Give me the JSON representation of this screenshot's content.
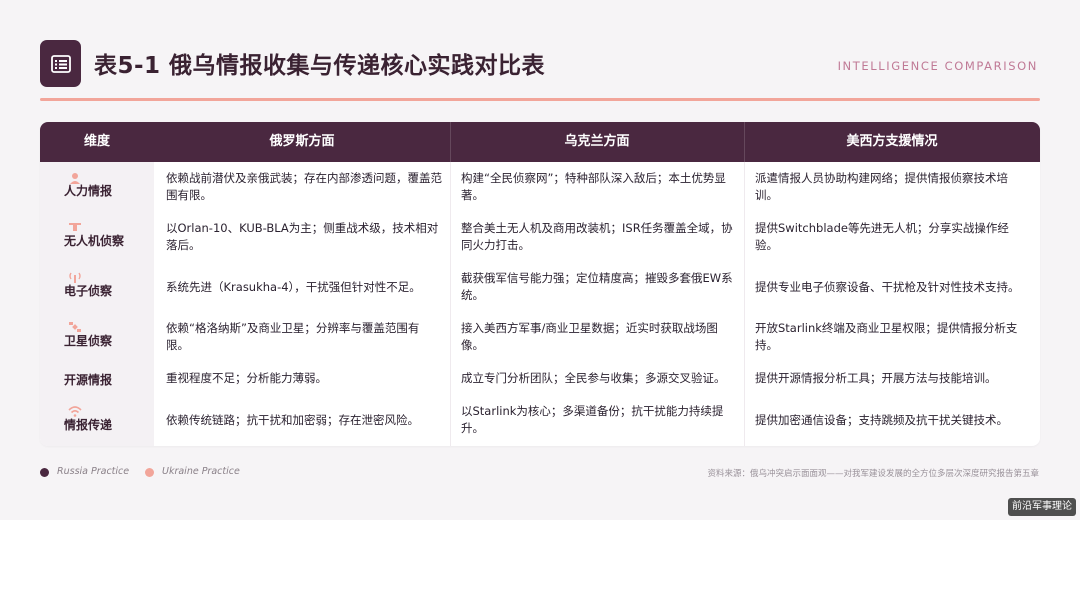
{
  "header": {
    "title": "表5-1 俄乌情报收集与传递核心实践对比表",
    "subtitle_en": "INTELLIGENCE COMPARISON"
  },
  "table": {
    "columns": [
      "维度",
      "俄罗斯方面",
      "乌克兰方面",
      "美西方支援情况"
    ],
    "rows": [
      {
        "dimension": "人力情报",
        "icon": "person-icon",
        "russia": "依赖战前潜伏及亲俄武装；存在内部渗透问题，覆盖范围有限。",
        "ukraine": "构建“全民侦察网”；特种部队深入敌后；本土优势显著。",
        "west": "派遣情报人员协助构建网络；提供情报侦察技术培训。"
      },
      {
        "dimension": "无人机侦察",
        "icon": "drone-icon",
        "russia": "以Orlan-10、KUB-BLA为主；侧重战术级，技术相对落后。",
        "ukraine": "整合美土无人机及商用改装机；ISR任务覆盖全域，协同火力打击。",
        "west": "提供Switchblade等先进无人机；分享实战操作经验。"
      },
      {
        "dimension": "电子侦察",
        "icon": "signal-icon",
        "russia": "系统先进（Krasukha-4），干扰强但针对性不足。",
        "ukraine": "截获俄军信号能力强；定位精度高；摧毁多套俄EW系统。",
        "west": "提供专业电子侦察设备、干扰枪及针对性技术支持。"
      },
      {
        "dimension": "卫星侦察",
        "icon": "satellite-icon",
        "russia": "依赖“格洛纳斯”及商业卫星；分辨率与覆盖范围有限。",
        "ukraine": "接入美西方军事/商业卫星数据；近实时获取战场图像。",
        "west": "开放Starlink终端及商业卫星权限；提供情报分析支持。"
      },
      {
        "dimension": "开源情报",
        "icon": "",
        "russia": "重视程度不足；分析能力薄弱。",
        "ukraine": "成立专门分析团队；全民参与收集；多源交叉验证。",
        "west": "提供开源情报分析工具；开展方法与技能培训。"
      },
      {
        "dimension": "情报传递",
        "icon": "wifi-icon",
        "russia": "依赖传统链路；抗干扰和加密弱；存在泄密风险。",
        "ukraine": "以Starlink为核心；多渠道备份；抗干扰能力持续提升。",
        "west": "提供加密通信设备；支持跳频及抗干扰关键技术。"
      }
    ]
  },
  "legend": [
    {
      "label": "Russia Practice",
      "color": "#4a2840"
    },
    {
      "label": "Ukraine Practice",
      "color": "#f2a59a"
    }
  ],
  "source": "资料来源：俄乌冲突启示面面观——对我军建设发展的全方位多层次深度研究报告第五章",
  "watermark": "前沿军事理论",
  "colors": {
    "primary": "#4a2840",
    "accent": "#f2a59a",
    "accent_text": "#c07a96"
  }
}
